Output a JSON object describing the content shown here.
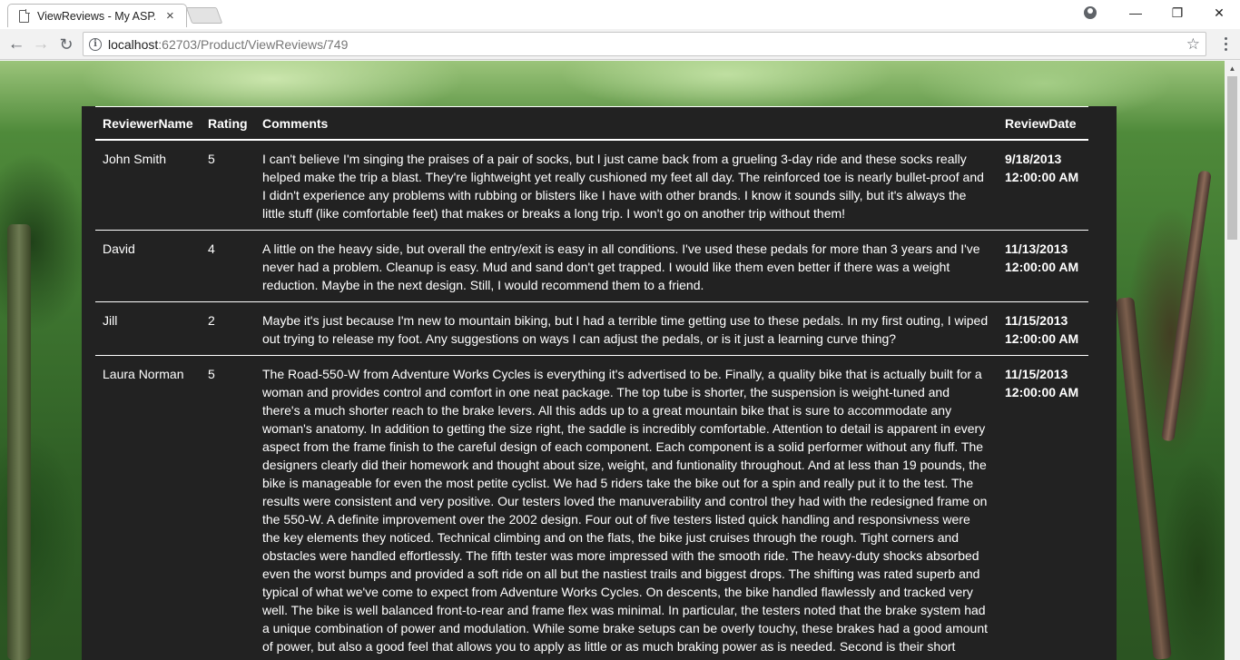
{
  "browser": {
    "tab_title": "ViewReviews - My ASP.N",
    "tab_close": "×",
    "url_host": "localhost",
    "url_path": ":62703/Product/ViewReviews/749",
    "icons": {
      "tab": "document-icon",
      "back": "back-arrow-icon",
      "forward": "forward-arrow-icon",
      "reload": "reload-icon",
      "info": "info-icon",
      "star": "star-icon",
      "profile": "profile-icon",
      "menu": "menu-dots-icon"
    }
  },
  "window_controls": {
    "minimize": "—",
    "maximize": "❐",
    "close": "✕"
  },
  "table": {
    "headers": {
      "name": "ReviewerName",
      "rating": "Rating",
      "comments": "Comments",
      "date": "ReviewDate"
    },
    "rows": [
      {
        "name": "John Smith",
        "rating": "5",
        "comments": "I can't believe I'm singing the praises of a pair of socks, but I just came back from a grueling 3-day ride and these socks really helped make the trip a blast. They're lightweight yet really cushioned my feet all day. The reinforced toe is nearly bullet-proof and I didn't experience any problems with rubbing or blisters like I have with other brands. I know it sounds silly, but it's always the little stuff (like comfortable feet) that makes or breaks a long trip. I won't go on another trip without them!",
        "date": "9/18/2013 12:00:00 AM"
      },
      {
        "name": "David",
        "rating": "4",
        "comments": "A little on the heavy side, but overall the entry/exit is easy in all conditions. I've used these pedals for more than 3 years and I've never had a problem. Cleanup is easy. Mud and sand don't get trapped. I would like them even better if there was a weight reduction. Maybe in the next design. Still, I would recommend them to a friend.",
        "date": "11/13/2013 12:00:00 AM"
      },
      {
        "name": "Jill",
        "rating": "2",
        "comments": "Maybe it's just because I'm new to mountain biking, but I had a terrible time getting use to these pedals. In my first outing, I wiped out trying to release my foot. Any suggestions on ways I can adjust the pedals, or is it just a learning curve thing?",
        "date": "11/15/2013 12:00:00 AM"
      },
      {
        "name": "Laura Norman",
        "rating": "5",
        "comments": "The Road-550-W from Adventure Works Cycles is everything it's advertised to be. Finally, a quality bike that is actually built for a woman and provides control and comfort in one neat package. The top tube is shorter, the suspension is weight-tuned and there's a much shorter reach to the brake levers. All this adds up to a great mountain bike that is sure to accommodate any woman's anatomy. In addition to getting the size right, the saddle is incredibly comfortable. Attention to detail is apparent in every aspect from the frame finish to the careful design of each component. Each component is a solid performer without any fluff. The designers clearly did their homework and thought about size, weight, and funtionality throughout. And at less than 19 pounds, the bike is manageable for even the most petite cyclist. We had 5 riders take the bike out for a spin and really put it to the test. The results were consistent and very positive. Our testers loved the manuverability and control they had with the redesigned frame on the 550-W. A definite improvement over the 2002 design. Four out of five testers listed quick handling and responsivness were the key elements they noticed. Technical climbing and on the flats, the bike just cruises through the rough. Tight corners and obstacles were handled effortlessly. The fifth tester was more impressed with the smooth ride. The heavy-duty shocks absorbed even the worst bumps and provided a soft ride on all but the nastiest trails and biggest drops. The shifting was rated superb and typical of what we've come to expect from Adventure Works Cycles. On descents, the bike handled flawlessly and tracked very well. The bike is well balanced front-to-rear and frame flex was minimal. In particular, the testers noted that the brake system had a unique combination of power and modulation. While some brake setups can be overly touchy, these brakes had a good amount of power, but also a good feel that allows you to apply as little or as much braking power as is needed. Second is their short break-",
        "date": "11/15/2013 12:00:00 AM"
      }
    ]
  }
}
